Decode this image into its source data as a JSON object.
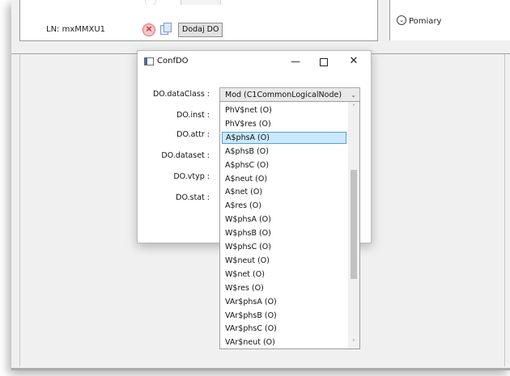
{
  "main": {
    "ln_label": "LN: mxMMXU1",
    "add_do_button": "Dodaj DO",
    "pomiary_label": "Pomiary"
  },
  "dialog": {
    "title": "ConfDO",
    "minimize": "—",
    "close": "✕",
    "fields": {
      "dataClass": "DO.dataClass :",
      "inst": "DO.inst :",
      "attr": "DO.attr :",
      "dataset": "DO.dataset :",
      "vtyp": "DO.vtyp :",
      "stat": "DO.stat :"
    },
    "dataClass_value": "Mod (C1CommonLogicalNode)"
  },
  "dropdown": {
    "selected_index": 2,
    "scroll_position": 0.5,
    "items": [
      "PhV$net (O)",
      "PhV$res (O)",
      "A$phsA (O)",
      "A$phsB (O)",
      "A$phsC (O)",
      "A$neut (O)",
      "A$net (O)",
      "A$res (O)",
      "W$phsA (O)",
      "W$phsB (O)",
      "W$phsC (O)",
      "W$neut (O)",
      "W$net (O)",
      "W$res (O)",
      "VAr$phsA (O)",
      "VAr$phsB (O)",
      "VAr$phsC (O)",
      "VAr$neut (O)"
    ]
  }
}
